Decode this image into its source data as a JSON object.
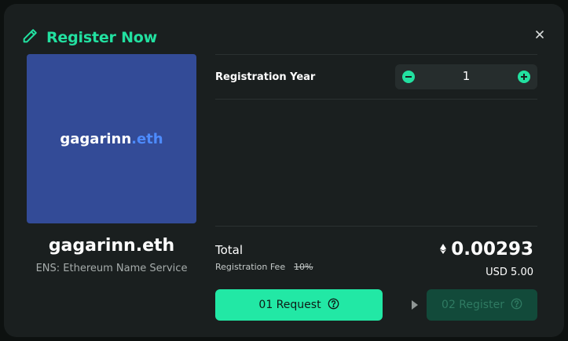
{
  "modal": {
    "title": "Register Now",
    "icon": "pencil-icon",
    "close_icon": "close-icon"
  },
  "preview": {
    "name": "gagarinn",
    "tld": ".eth",
    "background_color": "#334b97",
    "tld_color": "#4d8bff"
  },
  "domain": {
    "full_name": "gagarinn.eth",
    "service": "ENS: Ethereum Name Service"
  },
  "registration": {
    "year_label": "Registration Year",
    "year_value": "1",
    "decrement_icon": "minus-circle-icon",
    "increment_icon": "plus-circle-icon"
  },
  "summary": {
    "total_label": "Total",
    "fee_label": "Registration Fee",
    "fee_percent": "10%",
    "eth_icon": "ethereum-icon",
    "eth_amount": "0.00293",
    "usd_amount": "USD 5.00"
  },
  "actions": {
    "request_label": "01 Request",
    "register_label": "02 Register",
    "help_icon": "question-circle-icon",
    "step_arrow_icon": "play-arrow-icon"
  },
  "colors": {
    "accent": "#22e0a0",
    "modal_bg": "#1a1f1f",
    "register_disabled_bg": "#124a3a"
  }
}
